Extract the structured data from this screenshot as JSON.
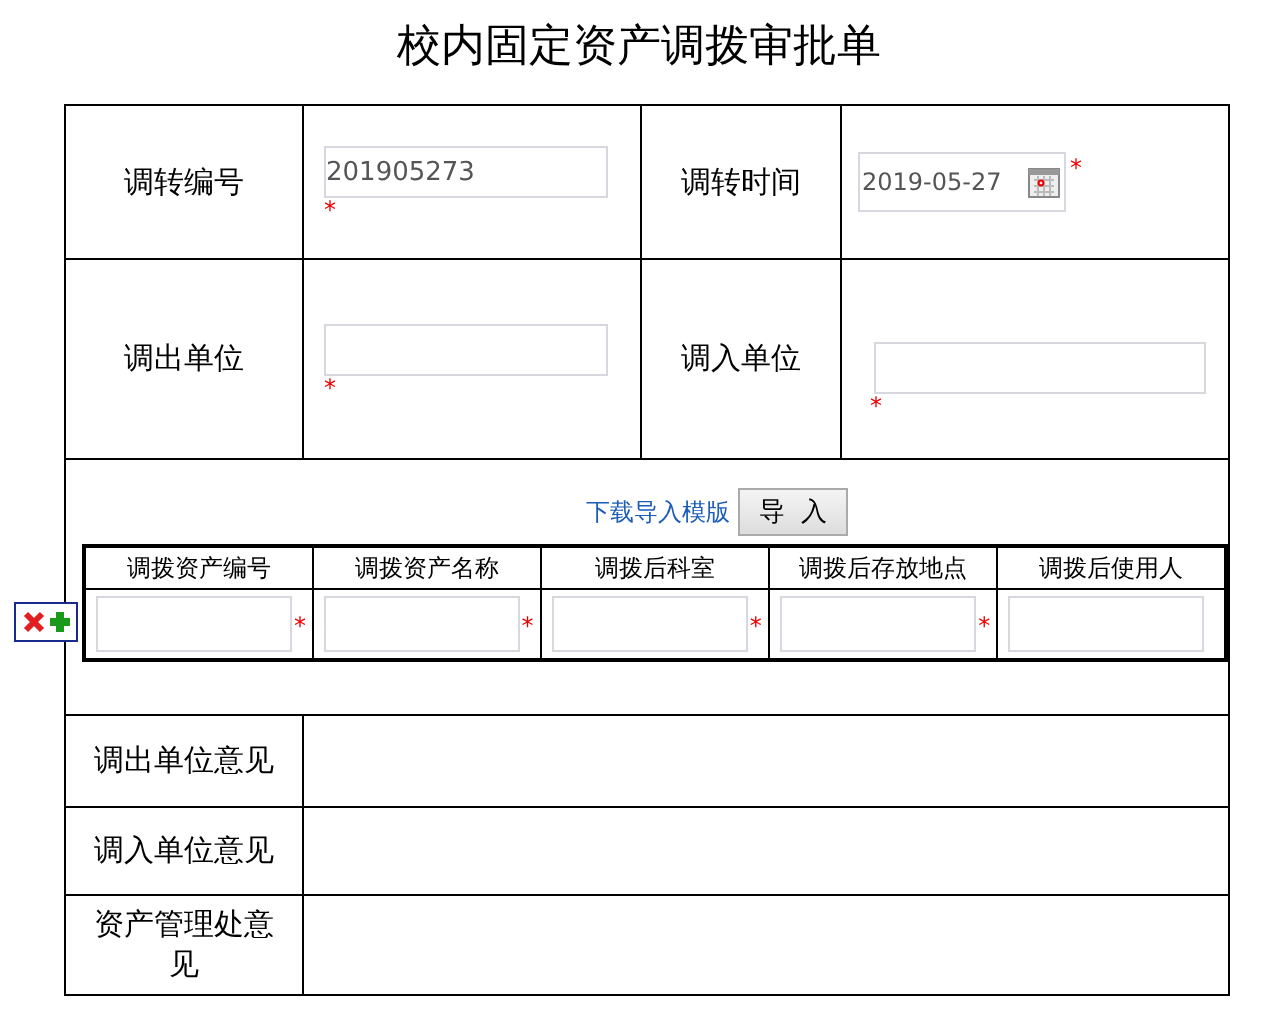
{
  "title": "校内固定资产调拨审批单",
  "fields": [
    {
      "label": "调转编号",
      "value": "201905273",
      "mark": "*",
      "kind": "text"
    },
    {
      "label": "调转时间",
      "value": "2019-05-27",
      "mark": "*",
      "kind": "date"
    },
    {
      "label": "调出单位",
      "mark": "*",
      "kind": "text"
    },
    {
      "label": "调入单位",
      "mark": "*",
      "kind": "text"
    }
  ],
  "import": {
    "link": "下载导入模版",
    "button": "导  入"
  },
  "detail": {
    "columns": [
      {
        "label": "调拨资产编号",
        "mark": "*"
      },
      {
        "label": "调拨资产名称",
        "mark": "*"
      },
      {
        "label": "调拨后科室",
        "mark": "*"
      },
      {
        "label": "调拨后存放地点",
        "mark": "*"
      },
      {
        "label": "调拨后使用人"
      }
    ]
  },
  "opinions": [
    {
      "label": "调出单位意见"
    },
    {
      "label": "调入单位意见"
    },
    {
      "label": "资产管理处意见"
    }
  ]
}
